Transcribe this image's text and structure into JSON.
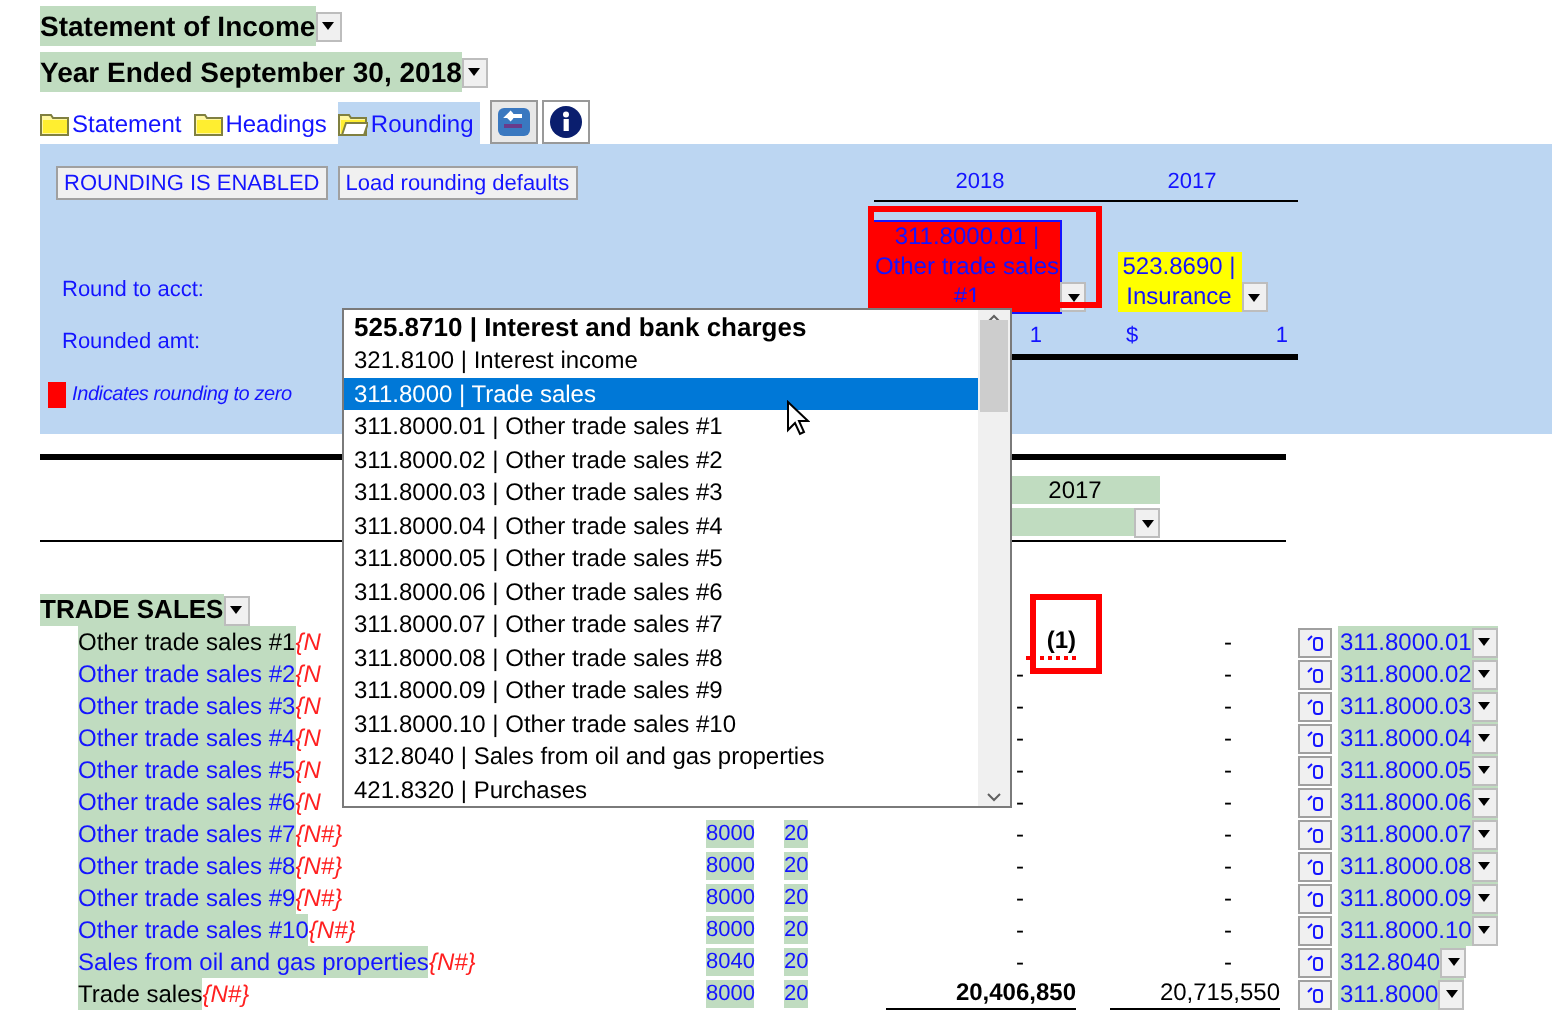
{
  "title": "Statement of Income",
  "period": "Year Ended September 30, 2018",
  "tabs": [
    {
      "label": "Statement",
      "selected": false
    },
    {
      "label": "Headings",
      "selected": false
    },
    {
      "label": "Rounding",
      "selected": true
    }
  ],
  "rounding": {
    "buttons": [
      "ROUNDING IS ENABLED",
      "Load rounding defaults"
    ],
    "columns": [
      "2018",
      "2017"
    ],
    "round_to_label": "Round to acct:",
    "round_to": [
      {
        "text": "311.8000.01 | Other trade sales #1",
        "color": "#ff0000"
      },
      {
        "text": "523.8690 | Insurance",
        "color": "#ffff00"
      }
    ],
    "rounded_label": "Rounded amt:",
    "rounded": [
      {
        "amount": "1"
      },
      {
        "currency": "$",
        "amount": "1"
      }
    ],
    "legend": "Indicates rounding to zero"
  },
  "dropdown": {
    "items": [
      {
        "text": "525.8710 | Interest and bank charges",
        "kind": "current",
        "selected": false
      },
      {
        "text": "321.8100 | Interest income",
        "kind": "option",
        "selected": false
      },
      {
        "text": "311.8000 | Trade sales",
        "kind": "option",
        "selected": true
      },
      {
        "text": "311.8000.01 | Other trade sales #1",
        "kind": "option",
        "selected": false
      },
      {
        "text": "311.8000.02 | Other trade sales #2",
        "kind": "option",
        "selected": false
      },
      {
        "text": "311.8000.03 | Other trade sales #3",
        "kind": "option",
        "selected": false
      },
      {
        "text": "311.8000.04 | Other trade sales #4",
        "kind": "option",
        "selected": false
      },
      {
        "text": "311.8000.05 | Other trade sales #5",
        "kind": "option",
        "selected": false
      },
      {
        "text": "311.8000.06 | Other trade sales #6",
        "kind": "option",
        "selected": false
      },
      {
        "text": "311.8000.07 | Other trade sales #7",
        "kind": "option",
        "selected": false
      },
      {
        "text": "311.8000.08 | Other trade sales #8",
        "kind": "option",
        "selected": false
      },
      {
        "text": "311.8000.09 | Other trade sales #9",
        "kind": "option",
        "selected": false
      },
      {
        "text": "311.8000.10 | Other trade sales #10",
        "kind": "option",
        "selected": false
      },
      {
        "text": "312.8040 | Sales from oil and gas properties",
        "kind": "option",
        "selected": false
      },
      {
        "text": "421.8320 | Purchases",
        "kind": "option",
        "selected": false
      }
    ]
  },
  "table": {
    "column_header": "2017",
    "section": "TRADE SALES",
    "rows": [
      {
        "label": "Other trade sales #1",
        "tag": "{N",
        "y2018": "(1)",
        "y2017": "-",
        "account": "311.8000.01",
        "kind": "detail",
        "highlighted": true
      },
      {
        "label": "Other trade sales #2",
        "tag": "{N",
        "y2018": "-",
        "y2017": "-",
        "account": "311.8000.02",
        "kind": "detail",
        "highlighted": false
      },
      {
        "label": "Other trade sales #3",
        "tag": "{N",
        "y2018": "-",
        "y2017": "-",
        "account": "311.8000.03",
        "kind": "detail",
        "highlighted": false
      },
      {
        "label": "Other trade sales #4",
        "tag": "{N",
        "y2018": "-",
        "y2017": "-",
        "account": "311.8000.04",
        "kind": "detail",
        "highlighted": false
      },
      {
        "label": "Other trade sales #5",
        "tag": "{N",
        "y2018": "-",
        "y2017": "-",
        "account": "311.8000.05",
        "kind": "detail",
        "highlighted": false
      },
      {
        "label": "Other trade sales #6",
        "tag": "{N",
        "y2018": "-",
        "y2017": "-",
        "account": "311.8000.06",
        "kind": "detail",
        "highlighted": false
      },
      {
        "label": "Other trade sales #7",
        "tag": "{N#}",
        "code": "8000",
        "decimals": "20",
        "y2018": "-",
        "y2017": "-",
        "account": "311.8000.07",
        "kind": "detail",
        "highlighted": false
      },
      {
        "label": "Other trade sales #8",
        "tag": "{N#}",
        "code": "8000",
        "decimals": "20",
        "y2018": "-",
        "y2017": "-",
        "account": "311.8000.08",
        "kind": "detail",
        "highlighted": false
      },
      {
        "label": "Other trade sales #9",
        "tag": "{N#}",
        "code": "8000",
        "decimals": "20",
        "y2018": "-",
        "y2017": "-",
        "account": "311.8000.09",
        "kind": "detail",
        "highlighted": false
      },
      {
        "label": "Other trade sales #10",
        "tag": "{N#}",
        "code": "8000",
        "decimals": "20",
        "y2018": "-",
        "y2017": "-",
        "account": "311.8000.10",
        "kind": "detail",
        "highlighted": false
      },
      {
        "label": "Sales from oil and gas properties",
        "tag": "{N#}",
        "code": "8040",
        "decimals": "20",
        "y2018": "-",
        "y2017": "-",
        "account": "312.8040",
        "kind": "detail",
        "highlighted": false
      },
      {
        "label": "Trade sales",
        "tag": "{N#}",
        "code": "8000",
        "decimals": "20",
        "y2018": "20,406,850",
        "y2017": "20,715,550",
        "account": "311.8000",
        "kind": "total",
        "highlighted": true
      }
    ]
  }
}
